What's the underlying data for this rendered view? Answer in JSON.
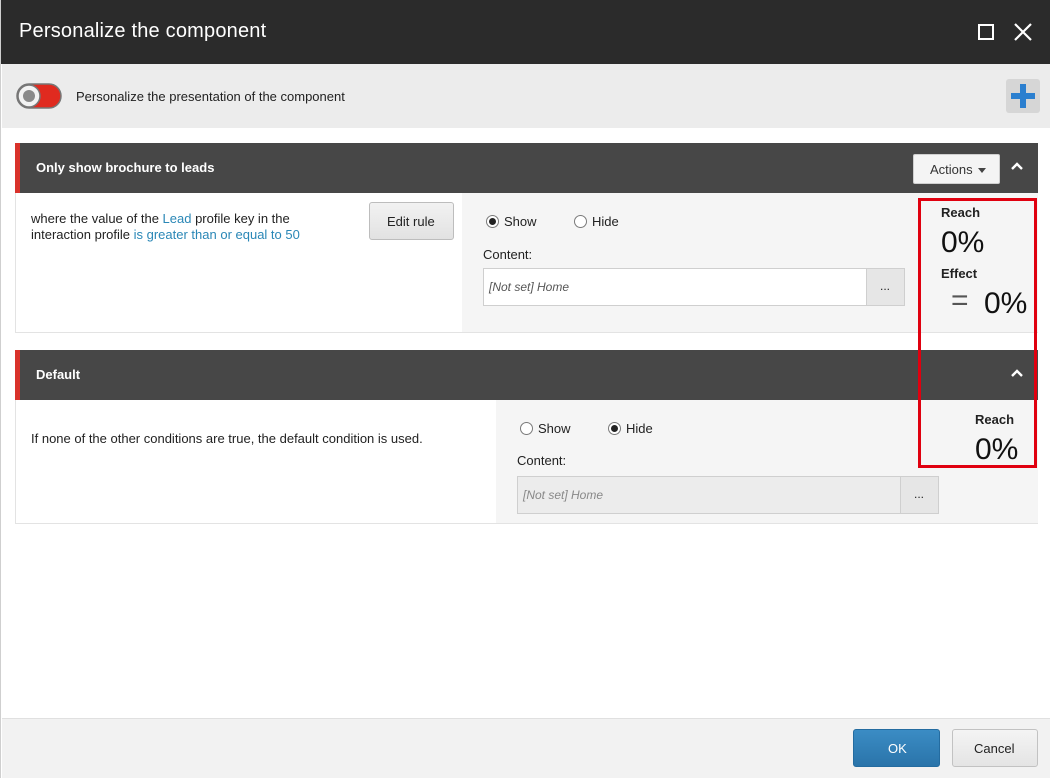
{
  "dialog": {
    "title": "Personalize the component",
    "header_label": "Personalize the presentation of the component"
  },
  "rules": [
    {
      "title": "Only show brochure to leads",
      "actions_label": "Actions",
      "condition": {
        "part1": "where the value of the ",
        "link1": "Lead",
        "part2": " profile key in the interaction profile ",
        "link2": "is greater than or equal to 50"
      },
      "edit_rule_label": "Edit rule",
      "show_label": "Show",
      "hide_label": "Hide",
      "selected": "Show",
      "content_label": "Content:",
      "content_value": "[Not set] Home",
      "browse_label": "...",
      "reach_label": "Reach",
      "reach_value": "0%",
      "effect_label": "Effect",
      "effect_value": "0%",
      "effect_symbol": "="
    },
    {
      "title": "Default",
      "description": "If none of the other conditions are true, the default condition is used.",
      "show_label": "Show",
      "hide_label": "Hide",
      "selected": "Hide",
      "content_label": "Content:",
      "content_value": "[Not set] Home",
      "browse_label": "...",
      "reach_label": "Reach",
      "reach_value": "0%"
    }
  ],
  "footer": {
    "ok_label": "OK",
    "cancel_label": "Cancel"
  },
  "colors": {
    "accent_red": "#d9322b",
    "highlight": "#e0000f",
    "link": "#2a87b6",
    "primary_button": "#2a74aa"
  },
  "icons": [
    "maximize-icon",
    "close-icon",
    "toggle-switch-icon",
    "plus-icon",
    "chevron-up-icon",
    "caret-down-icon"
  ]
}
